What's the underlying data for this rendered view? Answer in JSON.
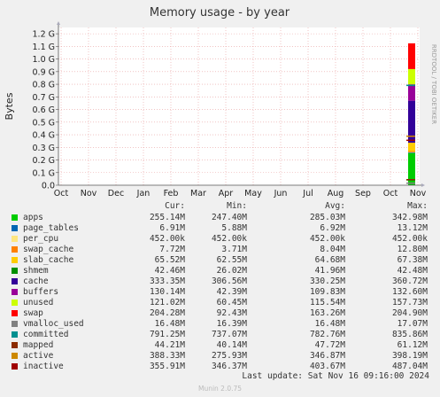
{
  "chart_data": {
    "type": "area",
    "title": "Memory usage - by year",
    "ylabel": "Bytes",
    "side_label": "RRDTOOL / TOBI OETIKER",
    "yticks": [
      "0.0",
      "0.1 G",
      "0.2 G",
      "0.3 G",
      "0.4 G",
      "0.5 G",
      "0.6 G",
      "0.7 G",
      "0.8 G",
      "0.9 G",
      "1.0 G",
      "1.1 G",
      "1.2 G"
    ],
    "ytick_values": [
      0,
      0.1,
      0.2,
      0.3,
      0.4,
      0.5,
      0.6,
      0.7,
      0.8,
      0.9,
      1.0,
      1.1,
      1.2
    ],
    "ylim": [
      0,
      1.25
    ],
    "yunit": "G",
    "xticks": [
      "Oct",
      "Nov",
      "Dec",
      "Jan",
      "Feb",
      "Mar",
      "Apr",
      "May",
      "Jun",
      "Jul",
      "Aug",
      "Sep",
      "Oct",
      "Nov"
    ],
    "grid": true,
    "data_visible_in": "Nov",
    "stack_values_G": [
      {
        "name": "apps",
        "value": 0.255
      },
      {
        "name": "page_tables",
        "value": 0.007
      },
      {
        "name": "per_cpu",
        "value": 0.0005
      },
      {
        "name": "swap_cache",
        "value": 0.008
      },
      {
        "name": "slab_cache",
        "value": 0.066
      },
      {
        "name": "cache",
        "value": 0.333
      },
      {
        "name": "buffers",
        "value": 0.13
      },
      {
        "name": "unused",
        "value": 0.121
      },
      {
        "name": "swap",
        "value": 0.204
      }
    ],
    "line_values_G": [
      {
        "name": "shmem",
        "value": 0.042
      },
      {
        "name": "vmalloc_used",
        "value": 0.016
      },
      {
        "name": "committed",
        "value": 0.791
      },
      {
        "name": "mapped",
        "value": 0.044
      },
      {
        "name": "active",
        "value": 0.388
      },
      {
        "name": "inactive",
        "value": 0.356
      }
    ]
  },
  "legend": {
    "headers": {
      "cur": "Cur:",
      "min": "Min:",
      "avg": "Avg:",
      "max": "Max:"
    },
    "rows": [
      {
        "name": "apps",
        "color": "#00cc00",
        "cur": "255.14M",
        "min": "247.40M",
        "avg": "285.03M",
        "max": "342.98M"
      },
      {
        "name": "page_tables",
        "color": "#0066b3",
        "cur": "6.91M",
        "min": "5.88M",
        "avg": "6.92M",
        "max": "13.12M"
      },
      {
        "name": "per_cpu",
        "color": "#ffe680",
        "cur": "452.00k",
        "min": "452.00k",
        "avg": "452.00k",
        "max": "452.00k"
      },
      {
        "name": "swap_cache",
        "color": "#ff8000",
        "cur": "7.72M",
        "min": "3.71M",
        "avg": "8.04M",
        "max": "12.80M"
      },
      {
        "name": "slab_cache",
        "color": "#ffcc00",
        "cur": "65.52M",
        "min": "62.55M",
        "avg": "64.68M",
        "max": "67.38M"
      },
      {
        "name": "shmem",
        "color": "#008f00",
        "cur": "42.46M",
        "min": "26.02M",
        "avg": "41.96M",
        "max": "42.48M"
      },
      {
        "name": "cache",
        "color": "#330099",
        "cur": "333.35M",
        "min": "306.56M",
        "avg": "330.25M",
        "max": "360.72M"
      },
      {
        "name": "buffers",
        "color": "#990099",
        "cur": "130.14M",
        "min": "42.39M",
        "avg": "109.83M",
        "max": "132.60M"
      },
      {
        "name": "unused",
        "color": "#ccff00",
        "cur": "121.02M",
        "min": "60.45M",
        "avg": "115.54M",
        "max": "157.73M"
      },
      {
        "name": "swap",
        "color": "#ff0000",
        "cur": "204.28M",
        "min": "92.43M",
        "avg": "163.26M",
        "max": "204.90M"
      },
      {
        "name": "vmalloc_used",
        "color": "#808080",
        "cur": "16.48M",
        "min": "16.39M",
        "avg": "16.48M",
        "max": "17.07M"
      },
      {
        "name": "committed",
        "color": "#008f8f",
        "cur": "791.25M",
        "min": "737.07M",
        "avg": "782.76M",
        "max": "835.86M"
      },
      {
        "name": "mapped",
        "color": "#8c2c00",
        "cur": "44.21M",
        "min": "40.14M",
        "avg": "47.72M",
        "max": "61.12M"
      },
      {
        "name": "active",
        "color": "#cc8800",
        "cur": "388.33M",
        "min": "275.93M",
        "avg": "346.87M",
        "max": "398.19M"
      },
      {
        "name": "inactive",
        "color": "#a00000",
        "cur": "355.91M",
        "min": "346.37M",
        "avg": "403.67M",
        "max": "487.04M"
      }
    ]
  },
  "last_update": "Last update: Sat Nov 16 09:16:00 2024",
  "footer": "Munin 2.0.75"
}
